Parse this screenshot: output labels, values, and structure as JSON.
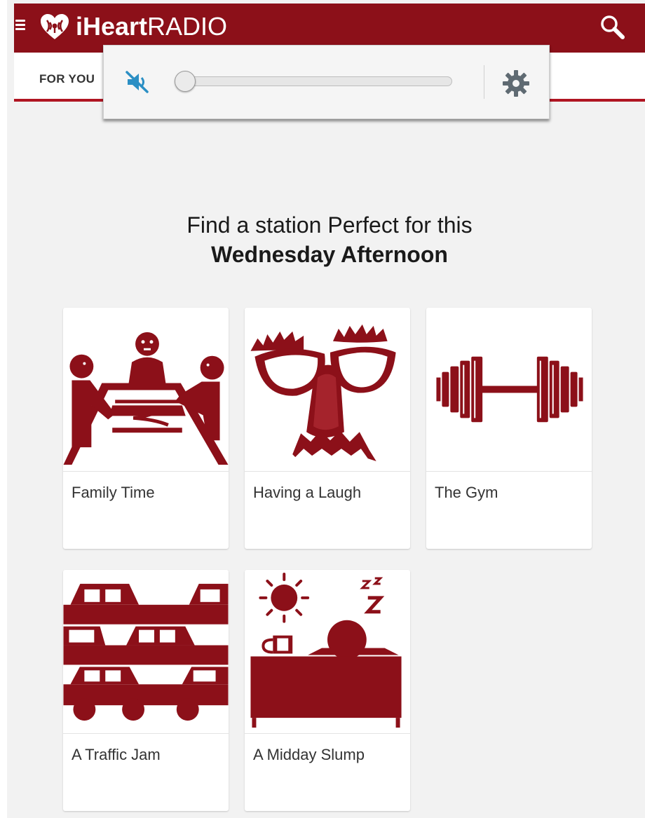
{
  "app": {
    "logo_bold": "iHeart",
    "logo_light": "RADIO",
    "brand_color": "#8c1019",
    "icons": [
      "menu-icon",
      "iheart-logo-icon",
      "search-icon",
      "mute-speaker-icon",
      "gear-icon"
    ]
  },
  "tabs": {
    "for_you": "FOR YOU"
  },
  "volume_popup": {
    "level": 0,
    "muted": true
  },
  "headline": {
    "line1": "Find a station Perfect for this",
    "line2": "Wednesday Afternoon"
  },
  "cards": [
    {
      "label": "Family Time",
      "icon": "family-table-icon"
    },
    {
      "label": "Having a Laugh",
      "icon": "funny-glasses-icon"
    },
    {
      "label": "The Gym",
      "icon": "dumbbell-icon"
    },
    {
      "label": "A Traffic Jam",
      "icon": "traffic-cars-icon"
    },
    {
      "label": "A Midday Slump",
      "icon": "sleepy-desk-icon"
    }
  ]
}
